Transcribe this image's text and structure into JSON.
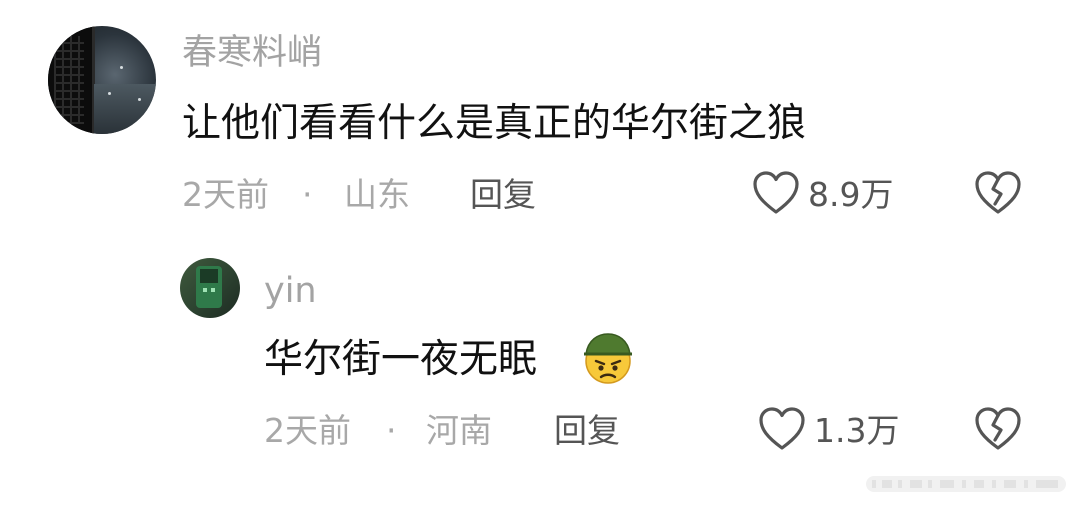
{
  "comments": [
    {
      "username": "春寒料峭",
      "text": "让他们看看什么是真正的华尔街之狼",
      "time": "2天前",
      "separator": "·",
      "location": "山东",
      "reply_label": "回复",
      "likes": "8.9万"
    },
    {
      "username": "yin",
      "text": "华尔街一夜无眠",
      "emoji": "angry-face-with-helmet",
      "time": "2天前",
      "separator": "·",
      "location": "河南",
      "reply_label": "回复",
      "likes": "1.3万"
    }
  ],
  "icons": {
    "like": "heart-outline-icon",
    "dislike": "broken-heart-icon"
  },
  "colors": {
    "text_primary": "#111111",
    "text_secondary": "#a3a3a3",
    "action_text": "#555555"
  }
}
